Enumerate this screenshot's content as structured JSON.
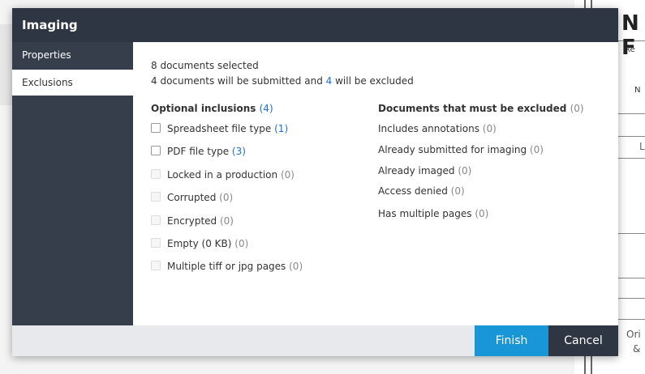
{
  "modal": {
    "title": "Imaging",
    "sidebar": [
      {
        "label": "Properties"
      },
      {
        "label": "Exclusions"
      }
    ],
    "summary": {
      "selected": "8 documents selected",
      "line2_prefix": "4 documents will be submitted and",
      "line2_count": "4",
      "line2_suffix": "will be excluded"
    },
    "optional": {
      "heading": "Optional inclusions",
      "count": "(4)",
      "items": [
        {
          "label": "Spreadsheet file type",
          "count": "(1)",
          "enabled": true
        },
        {
          "label": "PDF file type",
          "count": "(3)",
          "enabled": true
        },
        {
          "label": "Locked in a production",
          "count": "(0)",
          "enabled": false
        },
        {
          "label": "Corrupted",
          "count": "(0)",
          "enabled": false
        },
        {
          "label": "Encrypted",
          "count": "(0)",
          "enabled": false
        },
        {
          "label": "Empty (0 KB)",
          "count": "(0)",
          "enabled": false
        },
        {
          "label": "Multiple tiff or jpg pages",
          "count": "(0)",
          "enabled": false
        }
      ]
    },
    "excluded": {
      "heading": "Documents that must be excluded",
      "count": "(0)",
      "items": [
        {
          "label": "Includes annotations",
          "count": "(0)"
        },
        {
          "label": "Already submitted for imaging",
          "count": "(0)"
        },
        {
          "label": "Already imaged",
          "count": "(0)"
        },
        {
          "label": "Access denied",
          "count": "(0)"
        },
        {
          "label": "Has multiple pages",
          "count": "(0)"
        }
      ]
    },
    "footer": {
      "finish_label": "Finish",
      "cancel_label": "Cancel"
    }
  },
  "background": {
    "heading": "N F",
    "cells": [
      "Re",
      "N",
      "L",
      "Ori",
      "&"
    ]
  },
  "colors": {
    "titlebar": "#2e3543",
    "sidebar": "#363d4b",
    "accent_link": "#1f6fd1",
    "finish_button": "#1996d7",
    "cancel_button": "#2e3543"
  }
}
